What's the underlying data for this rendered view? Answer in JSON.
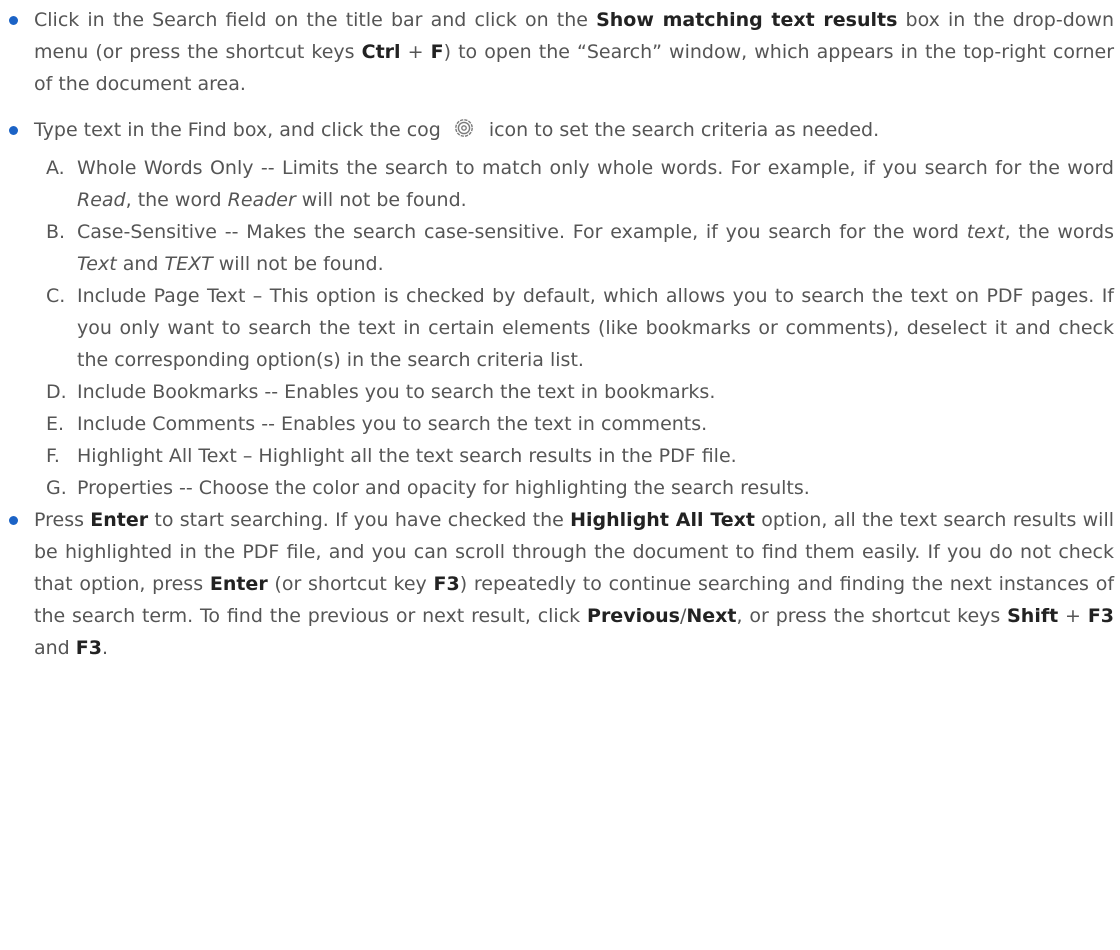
{
  "bullets": [
    {
      "parts": [
        {
          "t": "Click in the Search field on the title bar and click on the "
        },
        {
          "t": "Show matching text results",
          "b": true
        },
        {
          "t": " box in the drop-down menu (or press the shortcut keys "
        },
        {
          "t": "Ctrl",
          "b": true
        },
        {
          "t": " + "
        },
        {
          "t": "F",
          "b": true
        },
        {
          "t": ") to open the “Search” window, which appears in the top-right corner of the document area."
        }
      ]
    },
    {
      "parts": [
        {
          "t": "Type text in the Find box, and click the cog"
        },
        {
          "icon": "gear-icon"
        },
        {
          "t": "icon to set the search criteria as needed."
        }
      ],
      "options": [
        {
          "marker": "A.",
          "parts": [
            {
              "t": "Whole Words Only -- Limits the search to match only whole words. For example, if you search for the word "
            },
            {
              "t": "Read",
              "i": true
            },
            {
              "t": ", the word "
            },
            {
              "t": "Reader",
              "i": true
            },
            {
              "t": " will not be found."
            }
          ]
        },
        {
          "marker": "B.",
          "parts": [
            {
              "t": "Case-Sensitive -- Makes the search case-sensitive. For example, if you search for the word "
            },
            {
              "t": "text",
              "i": true
            },
            {
              "t": ", the words "
            },
            {
              "t": "Text",
              "i": true
            },
            {
              "t": " and "
            },
            {
              "t": "TEXT",
              "i": true
            },
            {
              "t": " will not be found."
            }
          ]
        },
        {
          "marker": "C.",
          "parts": [
            {
              "t": "Include Page Text – This option is checked by default, which allows you to search the text on PDF pages. If you only want to search the text in certain elements (like bookmarks or comments), deselect it and check the corresponding option(s) in the search criteria list."
            }
          ]
        },
        {
          "marker": "D.",
          "parts": [
            {
              "t": "Include Bookmarks -- Enables you to search the text in bookmarks."
            }
          ]
        },
        {
          "marker": "E.",
          "parts": [
            {
              "t": "Include Comments -- Enables you to search the text in comments."
            }
          ]
        },
        {
          "marker": "F.",
          "parts": [
            {
              "t": "Highlight All Text – Highlight all the text search results in the PDF file."
            }
          ]
        },
        {
          "marker": "G.",
          "parts": [
            {
              "t": "Properties -- Choose the color and opacity for highlighting the search results."
            }
          ]
        }
      ]
    },
    {
      "parts": [
        {
          "t": "Press "
        },
        {
          "t": "Enter",
          "b": true
        },
        {
          "t": " to start searching. If you have checked the "
        },
        {
          "t": "Highlight All Text",
          "b": true
        },
        {
          "t": " option, all the text search results will be highlighted in the PDF file, and you can scroll through the document to find them easily. If you do not check that option, press "
        },
        {
          "t": "Enter",
          "b": true
        },
        {
          "t": " (or shortcut key "
        },
        {
          "t": "F3",
          "b": true
        },
        {
          "t": ") repeatedly to continue searching and finding the next instances of the search term. To find the previous or next result, click "
        },
        {
          "t": "Previous",
          "b": true
        },
        {
          "t": "/"
        },
        {
          "t": "Next",
          "b": true
        },
        {
          "t": ", or press the shortcut keys "
        },
        {
          "t": "Shift",
          "b": true
        },
        {
          "t": " + "
        },
        {
          "t": "F3",
          "b": true
        },
        {
          "t": " and "
        },
        {
          "t": "F3",
          "b": true
        },
        {
          "t": "."
        }
      ]
    }
  ],
  "colors": {
    "text": "#555555",
    "bold_text": "#222222",
    "bullet": "#1b63c6",
    "icon": "#7a7a7a"
  }
}
